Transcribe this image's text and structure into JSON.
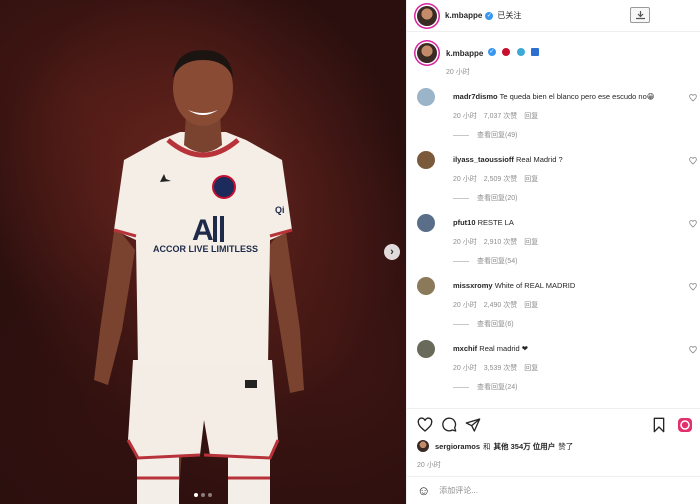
{
  "post": {
    "username": "k.mbappe",
    "follow_status": "已关注",
    "caption_time": "20 小时",
    "caption_emojis": [
      "#c8102e",
      "#3fa9d6",
      "#2d6fd1"
    ],
    "image": {
      "jersey_sponsor": "ACCOR LIVE LIMITLESS",
      "jersey_logo": "A|I",
      "sleeve_text": "Qi",
      "carousel_dots": 3,
      "active_dot": 1
    }
  },
  "comments": [
    {
      "username": "madr7dismo",
      "text": "Te queda bien el blanco pero ese escudo no😁",
      "time": "20 小时",
      "likes": "7,037 次赞",
      "reply": "回复",
      "view_replies": "查看回复(49)"
    },
    {
      "username": "ilyass_taoussioff",
      "text": "Real Madrid ?",
      "time": "20 小时",
      "likes": "2,509 次赞",
      "reply": "回复",
      "view_replies": "查看回复(20)"
    },
    {
      "username": "pfut10",
      "text": "RESTE LA",
      "time": "20 小时",
      "likes": "2,910 次赞",
      "reply": "回复",
      "view_replies": "查看回复(54)"
    },
    {
      "username": "missxromy",
      "text": "White of REAL MADRID",
      "time": "20 小时",
      "likes": "2,490 次赞",
      "reply": "回复",
      "view_replies": "查看回复(6)"
    },
    {
      "username": "mxchif",
      "text": "Real madrid ❤",
      "time": "20 小时",
      "likes": "3,539 次赞",
      "reply": "回复",
      "view_replies": "查看回复(24)"
    }
  ],
  "likes": {
    "user": "sergioramos",
    "connector": "和",
    "count_text": "其他 354万 位用户",
    "suffix": "赞了"
  },
  "post_time": "20 小时",
  "comment_input": {
    "placeholder": "添加评论..."
  },
  "icons": {
    "like": "heart-icon",
    "comment": "comment-icon",
    "share": "send-icon",
    "save": "bookmark-icon",
    "emoji": "smile-icon",
    "download": "download-icon",
    "next": "chevron-right-icon"
  }
}
